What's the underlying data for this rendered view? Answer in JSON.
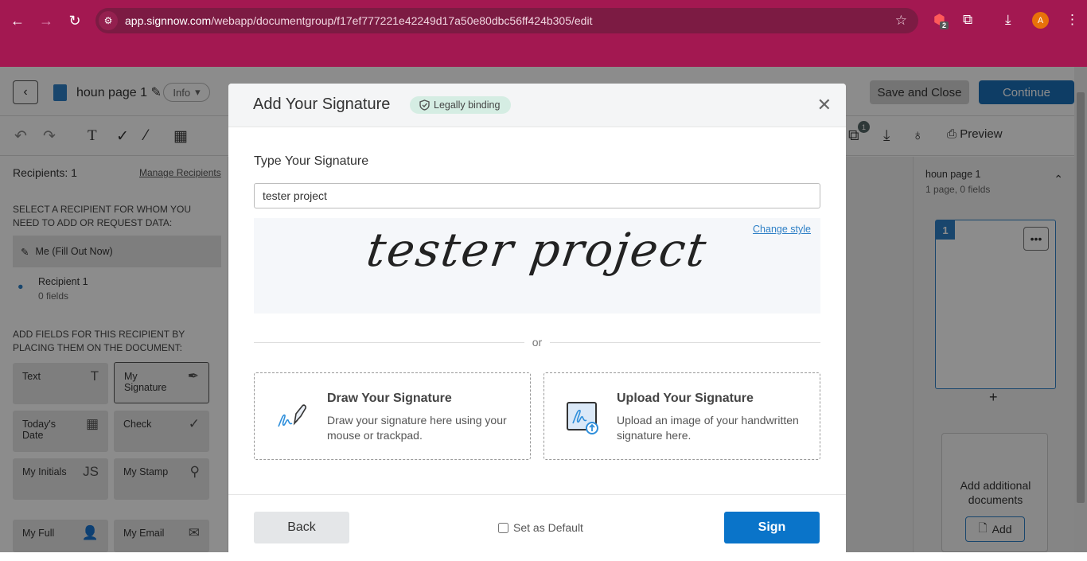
{
  "browser": {
    "url_host": "app.signnow.com",
    "url_path": "/webapp/documentgroup/f17ef777221e42249d17a50e80dbc56ff424b305/edit",
    "extension_badge": "2",
    "profile_initial": "A"
  },
  "header": {
    "doc_title": "houn page 1",
    "info_label": "Info",
    "save_close_label": "Save and Close",
    "continue_label": "Continue"
  },
  "toolbar": {
    "copies_badge": "1",
    "preview_label": "Preview"
  },
  "left_panel": {
    "recipients_count": "Recipients: 1",
    "manage_link": "Manage Recipients",
    "select_label": "Select a recipient for whom you need to add or request data:",
    "me_item": "Me (Fill Out Now)",
    "recipient_name": "Recipient 1",
    "recipient_fields": "0 fields",
    "add_fields_label": "Add fields for this recipient by placing them on the document:",
    "fields": [
      {
        "label": "Text",
        "icon": "T"
      },
      {
        "label": "My Signature",
        "icon": "✒"
      },
      {
        "label": "Today's Date",
        "icon": "▦"
      },
      {
        "label": "Check",
        "icon": "✓"
      },
      {
        "label": "My Initials",
        "icon": "JS"
      },
      {
        "label": "My Stamp",
        "icon": "⚲"
      },
      {
        "label": "My Full",
        "icon": "👤"
      },
      {
        "label": "My Email",
        "icon": "✉"
      }
    ]
  },
  "right_panel": {
    "doc_title": "houn page 1",
    "doc_meta": "1 page, 0 fields",
    "page_number": "1",
    "more_label": "•••",
    "add_docs_text": "Add additional documents",
    "add_label": "Add"
  },
  "modal": {
    "title": "Add Your Signature",
    "legal_badge": "Legally binding",
    "type_label": "Type Your Signature",
    "signature_value": "tester project",
    "change_style": "Change style",
    "or_text": "or",
    "draw_title": "Draw Your Signature",
    "draw_desc": "Draw your signature here using your mouse or trackpad.",
    "upload_title": "Upload Your Signature",
    "upload_desc": "Upload an image of your handwritten signature here.",
    "back_label": "Back",
    "set_default_label": "Set as Default",
    "set_default_checked": false,
    "sign_label": "Sign"
  }
}
